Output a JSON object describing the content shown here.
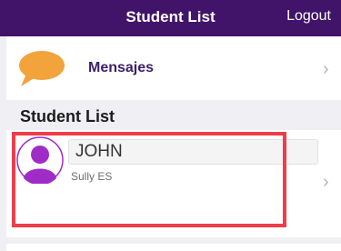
{
  "header": {
    "title": "Student List",
    "logout_label": "Logout"
  },
  "messages_row": {
    "label": "Mensajes",
    "icon": "speech-bubble-icon"
  },
  "section": {
    "title": "Student List"
  },
  "student": {
    "name": "JOHN",
    "school": "Sully ES",
    "icon": "person-avatar-icon"
  },
  "colors": {
    "header_bg": "#41146a",
    "accent_label": "#3c1f6b",
    "bubble": "#f2a33c",
    "avatar": "#a02cc8",
    "highlight": "#ef3d4a"
  }
}
